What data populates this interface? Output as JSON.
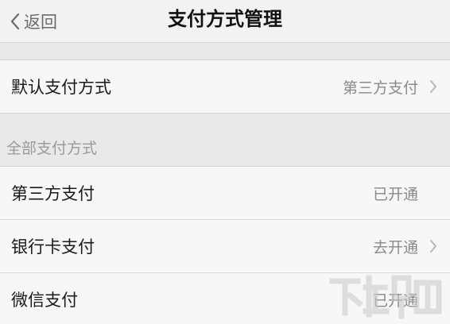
{
  "navbar": {
    "back_label": "返回",
    "title": "支付方式管理"
  },
  "default_row": {
    "label": "默认支付方式",
    "value": "第三方支付"
  },
  "section": {
    "header": "全部支付方式",
    "items": [
      {
        "label": "第三方支付",
        "status": "已开通",
        "chevron": false
      },
      {
        "label": "银行卡支付",
        "status": "去开通",
        "chevron": true
      },
      {
        "label": "微信支付",
        "status": "已开通",
        "chevron": false
      }
    ]
  },
  "colors": {
    "background": "#e9e9e9",
    "cell": "#f7f7f7",
    "secondary_text": "#8a8a8a"
  },
  "icons": {
    "back": "chevron-left-icon",
    "disclosure": "chevron-right-icon"
  }
}
